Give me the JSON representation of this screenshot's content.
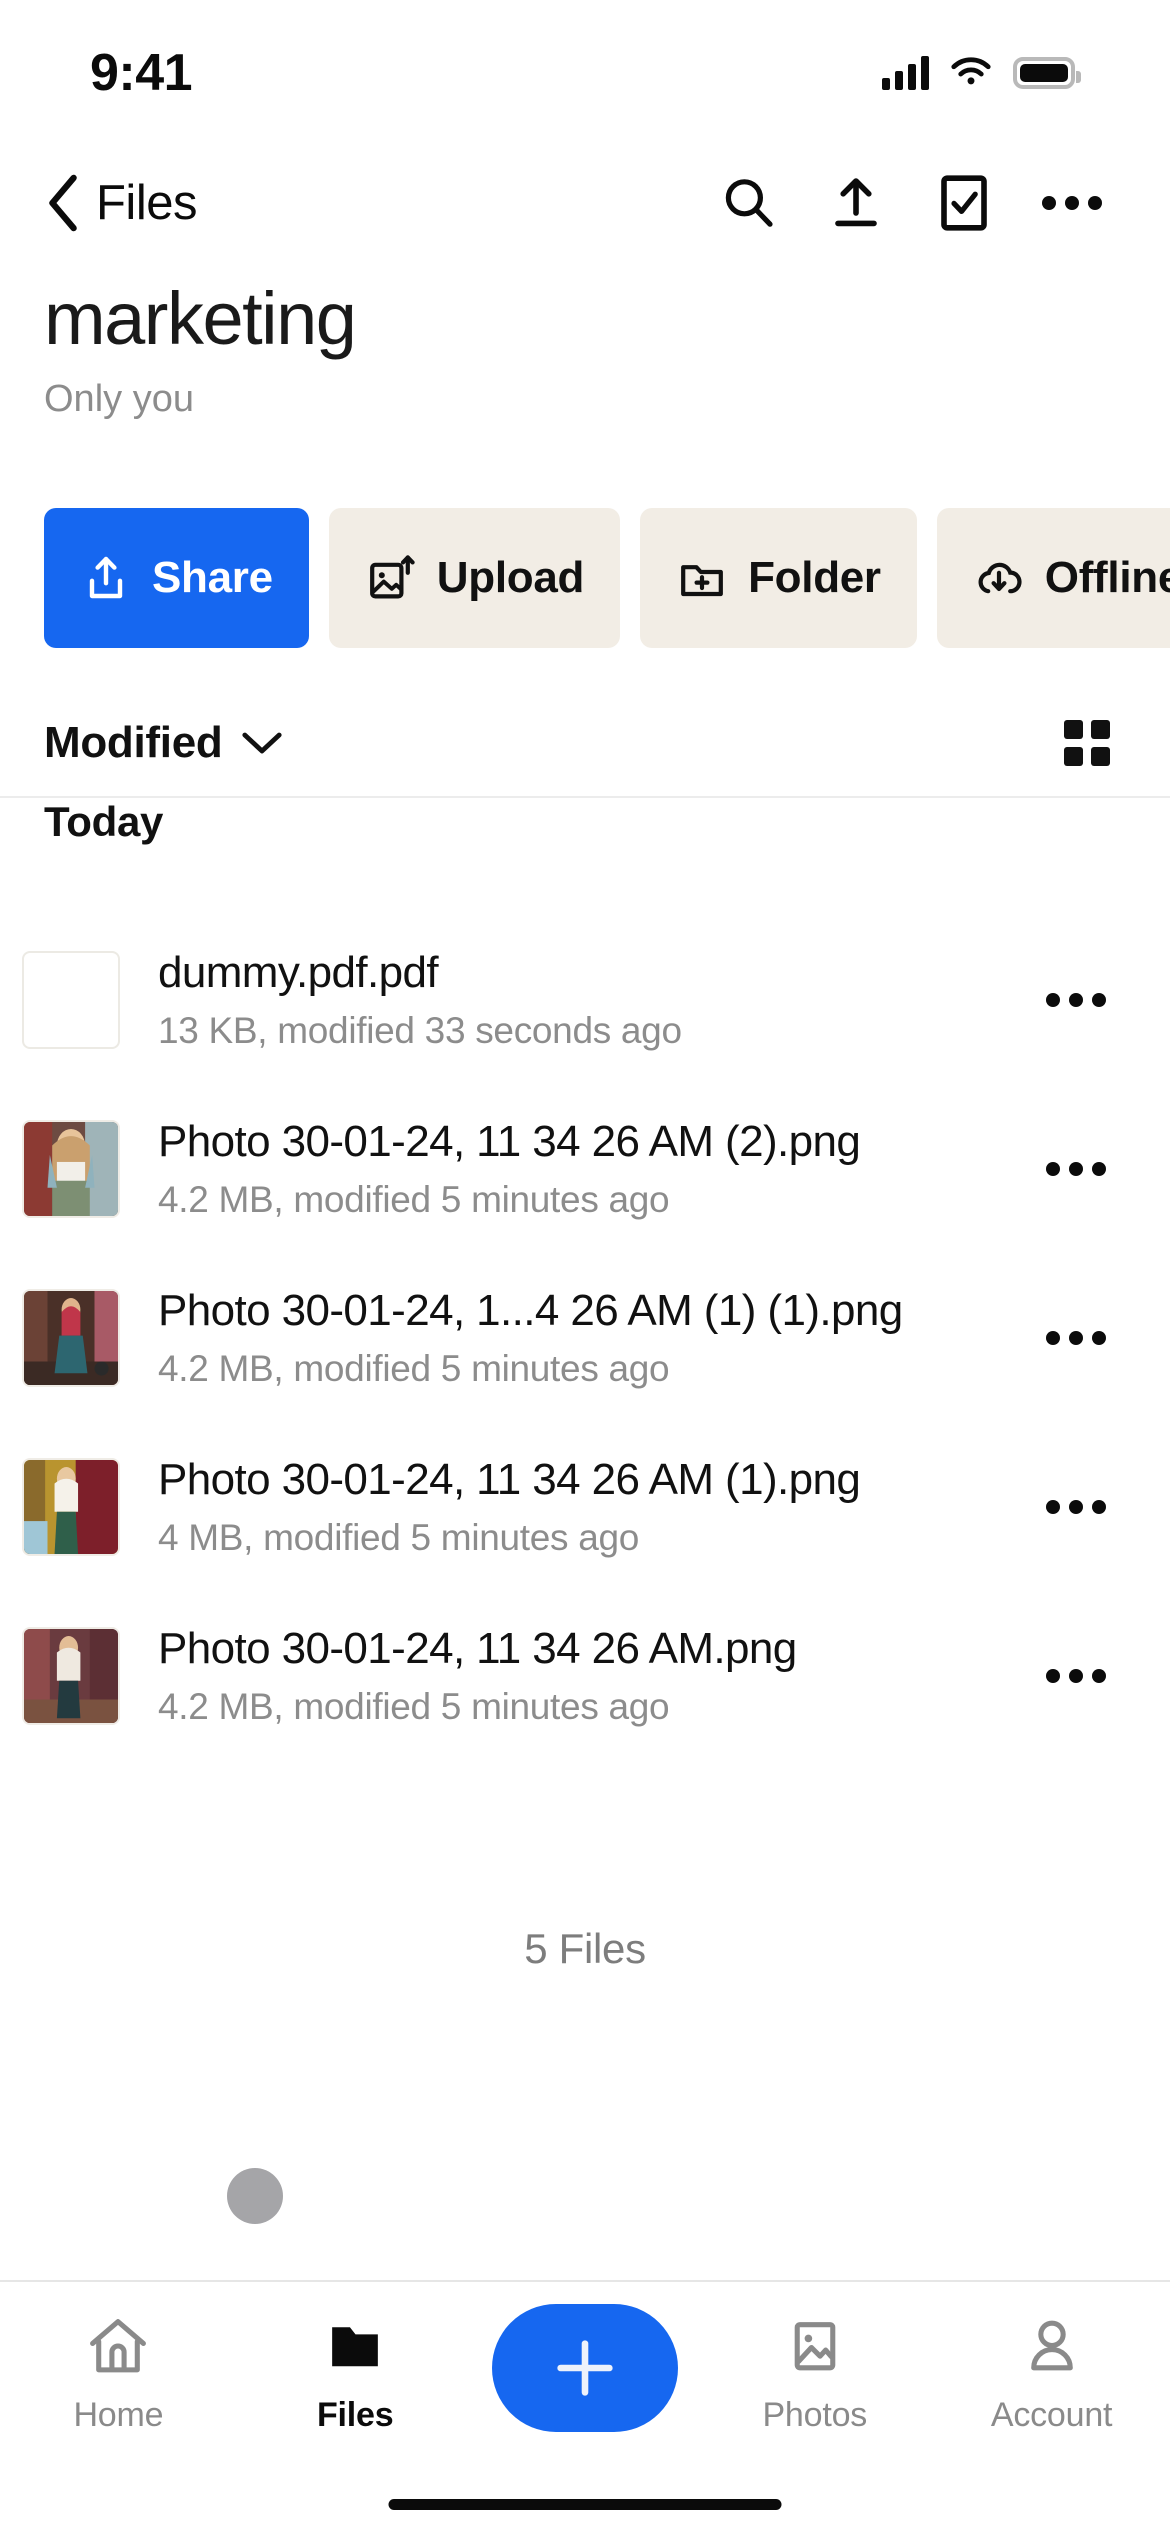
{
  "status_bar": {
    "time": "9:41",
    "cellular_icon": "cellular-signal-icon",
    "wifi_icon": "wifi-icon",
    "battery_icon": "battery-full-icon"
  },
  "nav_bar": {
    "back_label": "Files",
    "back_icon": "chevron-left-icon",
    "actions": [
      {
        "name": "search",
        "icon": "search-icon"
      },
      {
        "name": "upload",
        "icon": "upload-icon"
      },
      {
        "name": "select",
        "icon": "checkbox-select-icon"
      },
      {
        "name": "more",
        "icon": "more-horizontal-icon"
      }
    ]
  },
  "header": {
    "title": "marketing",
    "subtitle": "Only you"
  },
  "action_chips": [
    {
      "label": "Share",
      "icon": "share-icon",
      "primary": true
    },
    {
      "label": "Upload",
      "icon": "image-upload-icon",
      "primary": false
    },
    {
      "label": "Folder",
      "icon": "folder-plus-icon",
      "primary": false
    },
    {
      "label": "Offline",
      "icon": "cloud-download-icon",
      "primary": false
    }
  ],
  "sort_bar": {
    "sort_label": "Modified",
    "sort_chevron_icon": "chevron-down-icon",
    "view_toggle_icon": "grid-view-icon"
  },
  "section": {
    "header": "Today"
  },
  "files": [
    {
      "name": "dummy.pdf.pdf",
      "meta": "13 KB, modified 33 seconds ago",
      "thumb_type": "document",
      "more_icon": "more-horizontal-icon"
    },
    {
      "name": "Photo 30-01-24, 11 34 26 AM (2).png",
      "meta": "4.2 MB, modified 5 minutes ago",
      "thumb_type": "photo",
      "more_icon": "more-horizontal-icon"
    },
    {
      "name": "Photo 30-01-24, 1...4 26 AM (1) (1).png",
      "meta": "4.2 MB, modified 5 minutes ago",
      "thumb_type": "photo",
      "more_icon": "more-horizontal-icon"
    },
    {
      "name": "Photo 30-01-24, 11 34 26 AM (1).png",
      "meta": "4 MB, modified 5 minutes ago",
      "thumb_type": "photo",
      "more_icon": "more-horizontal-icon"
    },
    {
      "name": "Photo 30-01-24, 11 34 26 AM.png",
      "meta": "4.2 MB, modified 5 minutes ago",
      "thumb_type": "photo",
      "more_icon": "more-horizontal-icon"
    }
  ],
  "footer": {
    "file_count": "5 Files"
  },
  "tab_bar": {
    "items": [
      {
        "label": "Home",
        "icon": "home-icon",
        "active": false
      },
      {
        "label": "Files",
        "icon": "folder-icon",
        "active": true
      },
      {
        "label": "Photos",
        "icon": "photos-icon",
        "active": false
      },
      {
        "label": "Account",
        "icon": "person-icon",
        "active": false
      }
    ],
    "fab": {
      "label": "+",
      "icon": "plus-icon"
    }
  },
  "colors": {
    "accent": "#1667f0",
    "chip_bg": "#f2ede5",
    "text_primary": "#111111",
    "text_secondary": "#8c8c8c"
  }
}
